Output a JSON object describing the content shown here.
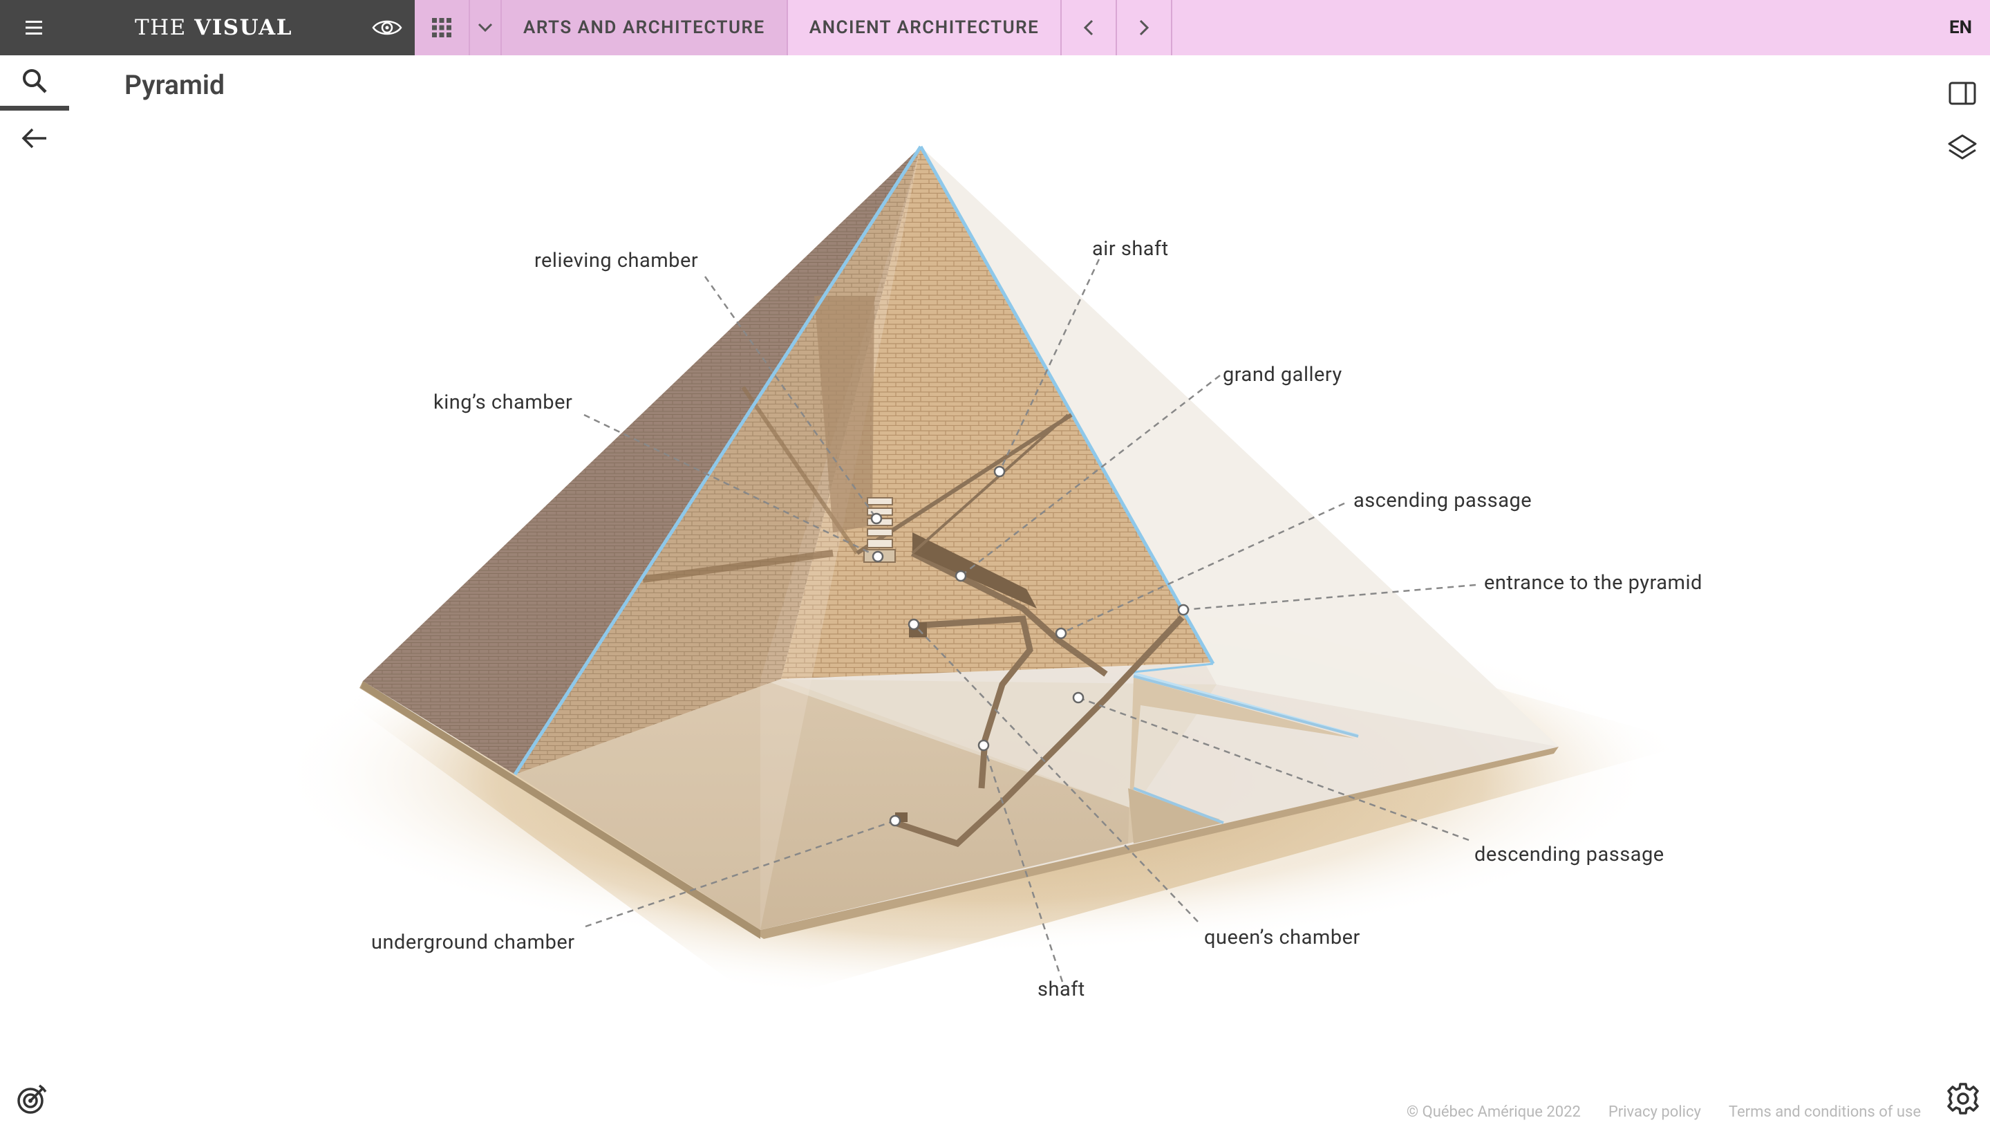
{
  "app": {
    "brand_prefix": "THE",
    "brand_name": "VISUAL",
    "language": "EN"
  },
  "nav": {
    "breadcrumbs": [
      "ARTS AND ARCHITECTURE",
      "ANCIENT ARCHITECTURE"
    ]
  },
  "page": {
    "title": "Pyramid"
  },
  "labels": {
    "relieving_chamber": "relieving chamber",
    "air_shaft": "air shaft",
    "kings_chamber": "king’s chamber",
    "grand_gallery": "grand gallery",
    "ascending_passage": "ascending passage",
    "entrance": "entrance to the pyramid",
    "descending_passage": "descending passage",
    "underground_chamber": "underground chamber",
    "queens_chamber": "queen’s chamber",
    "shaft": "shaft"
  },
  "footer": {
    "copyright": "© Québec Amérique 2022",
    "privacy": "Privacy policy",
    "terms": "Terms and conditions of use"
  },
  "colors": {
    "nav_bg": "#f4cdf0",
    "brand_bg": "#474747",
    "edge_blue": "#8ec8ea"
  }
}
